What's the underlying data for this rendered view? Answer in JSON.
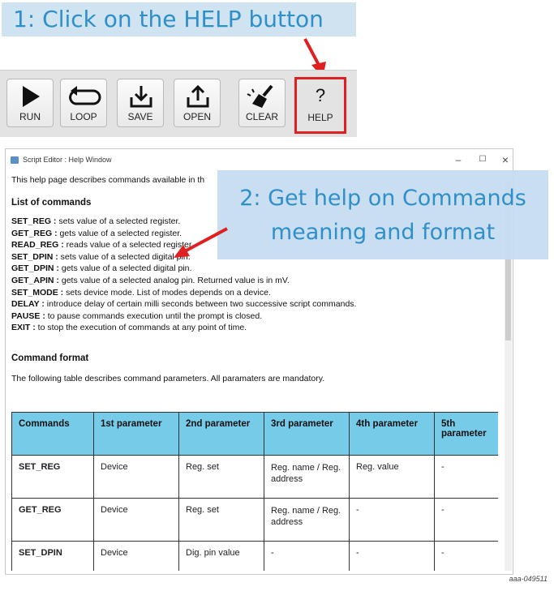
{
  "step1": {
    "text": "1: Click on the HELP button"
  },
  "step2": {
    "line1": "2: Get help on Commands",
    "line2": "meaning and format"
  },
  "toolbar": {
    "buttons": [
      {
        "label": "RUN",
        "icon": "play-icon"
      },
      {
        "label": "LOOP",
        "icon": "loop-icon"
      },
      {
        "label": "SAVE",
        "icon": "save-icon"
      },
      {
        "label": "OPEN",
        "icon": "open-icon"
      },
      {
        "label": "CLEAR",
        "icon": "broom-icon"
      },
      {
        "label": "HELP",
        "icon": "question-icon",
        "glyph": "?"
      }
    ]
  },
  "window": {
    "title": "Script Editor : Help Window",
    "controls": {
      "minimize": "–",
      "maximize": "☐",
      "close": "×"
    }
  },
  "help": {
    "intro": "This help page describes commands available in th",
    "list_title": "List of commands",
    "commands": [
      {
        "name": "SET_REG :",
        "desc": " sets value of a selected register."
      },
      {
        "name": "GET_REG :",
        "desc": " gets value of a selected register."
      },
      {
        "name": "READ_REG :",
        "desc": " reads value of a selected register."
      },
      {
        "name": "SET_DPIN :",
        "desc": " sets value of a selected digital pin."
      },
      {
        "name": "GET_DPIN :",
        "desc": " gets value of a selected digital pin."
      },
      {
        "name": "GET_APIN :",
        "desc": " gets value of a selected analog pin. Returned value is in mV."
      },
      {
        "name": "SET_MODE :",
        "desc": " sets device mode. List of modes depends on a device."
      },
      {
        "name": "DELAY :",
        "desc": " introduce delay of certain milli seconds between two successive script commands."
      },
      {
        "name": "PAUSE :",
        "desc": " to pause commands execution until the prompt is closed."
      },
      {
        "name": "EXIT :",
        "desc": " to stop the execution of commands at any point of time."
      }
    ],
    "format_title": "Command format",
    "format_desc": "The following table describes command parameters. All paramaters are mandatory."
  },
  "table": {
    "headers": [
      "Commands",
      "1st parameter",
      "2nd parameter",
      "3rd parameter",
      "4th parameter",
      "5th parameter"
    ],
    "rows": [
      [
        "SET_REG",
        "Device",
        "Reg. set",
        "Reg. name / Reg. address",
        "Reg. value",
        "-"
      ],
      [
        "GET_REG",
        "Device",
        "Reg. set",
        "Reg. name / Reg. address",
        "-",
        "-"
      ],
      [
        "SET_DPIN",
        "Device",
        "Dig. pin value",
        "-",
        "-",
        "-"
      ]
    ]
  },
  "figure_id": "aaa-049511",
  "colors": {
    "banner_text": "#2f8fc9",
    "banner_bg": "#cfe3f1",
    "highlight": "#e02020",
    "table_header": "#76cbe9"
  }
}
